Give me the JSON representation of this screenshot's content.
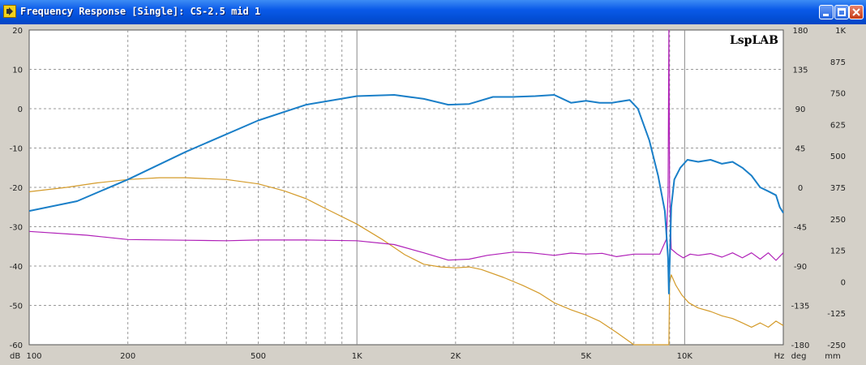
{
  "window": {
    "title": "Frequency Response [Single]: CS-2.5 mid 1",
    "minimize_label": "minimize",
    "maximize_label": "maximize",
    "close_label": "close"
  },
  "watermark": "LspLAB",
  "colors": {
    "spl": "#1a7fc8",
    "phase": "#d49b2a",
    "excursion": "#b020b8",
    "grid": "#7a7a7a",
    "background": "#ffffff"
  },
  "chart_data": {
    "type": "line",
    "x_scale": "log",
    "xlim": [
      100,
      20000
    ],
    "x_ticks": [
      {
        "value": 100,
        "label": "100"
      },
      {
        "value": 200,
        "label": "200"
      },
      {
        "value": 500,
        "label": "500"
      },
      {
        "value": 1000,
        "label": "1K"
      },
      {
        "value": 2000,
        "label": "2K"
      },
      {
        "value": 5000,
        "label": "5K"
      },
      {
        "value": 10000,
        "label": "10K"
      }
    ],
    "x_unit": "Hz",
    "y_left": {
      "unit": "dB",
      "lim": [
        -60,
        20
      ],
      "ticks": [
        20,
        10,
        0,
        -10,
        -20,
        -30,
        -40,
        -50,
        -60
      ]
    },
    "y_right1": {
      "unit": "deg",
      "lim": [
        -180,
        180
      ],
      "ticks": [
        180,
        135,
        90,
        45,
        0,
        -45,
        -90,
        -135,
        -180
      ]
    },
    "y_right2": {
      "unit": "mm",
      "lim": [
        "-250",
        "1K"
      ],
      "ticks": [
        "1K",
        "875",
        "750",
        "625",
        "500",
        "375",
        "250",
        "125",
        "0",
        "-125",
        "-250"
      ]
    },
    "grid": true,
    "series": [
      {
        "axis": "dB",
        "color": "#1a7fc8",
        "points": [
          [
            100,
            -26
          ],
          [
            140,
            -23.5
          ],
          [
            200,
            -18
          ],
          [
            300,
            -11
          ],
          [
            500,
            -3
          ],
          [
            700,
            1
          ],
          [
            1000,
            3.2
          ],
          [
            1300,
            3.5
          ],
          [
            1600,
            2.5
          ],
          [
            1900,
            1
          ],
          [
            2200,
            1.2
          ],
          [
            2600,
            3
          ],
          [
            3000,
            3
          ],
          [
            3500,
            3.2
          ],
          [
            4000,
            3.5
          ],
          [
            4500,
            1.5
          ],
          [
            5000,
            2
          ],
          [
            5500,
            1.5
          ],
          [
            6000,
            1.5
          ],
          [
            6800,
            2.2
          ],
          [
            7200,
            0
          ],
          [
            7800,
            -8
          ],
          [
            8300,
            -17
          ],
          [
            8700,
            -26
          ],
          [
            8900,
            -38
          ],
          [
            8950,
            -47
          ],
          [
            9000,
            -40
          ],
          [
            9100,
            -25
          ],
          [
            9300,
            -18
          ],
          [
            9700,
            -15
          ],
          [
            10200,
            -13
          ],
          [
            11000,
            -13.5
          ],
          [
            12000,
            -13
          ],
          [
            13000,
            -14
          ],
          [
            14000,
            -13.5
          ],
          [
            15000,
            -15
          ],
          [
            16000,
            -17
          ],
          [
            17000,
            -20
          ],
          [
            18000,
            -21
          ],
          [
            19000,
            -22
          ],
          [
            19500,
            -25
          ],
          [
            20000,
            -26.5
          ]
        ]
      },
      {
        "axis": "deg",
        "color": "#d49b2a",
        "points": [
          [
            100,
            -5
          ],
          [
            130,
            0
          ],
          [
            160,
            5
          ],
          [
            200,
            9
          ],
          [
            250,
            11
          ],
          [
            300,
            11
          ],
          [
            400,
            9
          ],
          [
            500,
            4
          ],
          [
            600,
            -4
          ],
          [
            700,
            -13
          ],
          [
            800,
            -24
          ],
          [
            1000,
            -42
          ],
          [
            1200,
            -60
          ],
          [
            1400,
            -77
          ],
          [
            1600,
            -88
          ],
          [
            1800,
            -91
          ],
          [
            2000,
            -92
          ],
          [
            2200,
            -91
          ],
          [
            2400,
            -94
          ],
          [
            2800,
            -103
          ],
          [
            3200,
            -112
          ],
          [
            3600,
            -121
          ],
          [
            4000,
            -132
          ],
          [
            4500,
            -140
          ],
          [
            5000,
            -146
          ],
          [
            5500,
            -153
          ],
          [
            6200,
            -166
          ],
          [
            7000,
            -198
          ],
          [
            7800,
            -233
          ],
          [
            8400,
            -258
          ],
          [
            8800,
            -268
          ],
          [
            8950,
            -272
          ],
          [
            9000,
            -110
          ],
          [
            9100,
            -100
          ],
          [
            9400,
            -112
          ],
          [
            9800,
            -123
          ],
          [
            10300,
            -132
          ],
          [
            11000,
            -138
          ],
          [
            12000,
            -142
          ],
          [
            13000,
            -147
          ],
          [
            14000,
            -150
          ],
          [
            15000,
            -155
          ],
          [
            16000,
            -160
          ],
          [
            17000,
            -155
          ],
          [
            18000,
            -160
          ],
          [
            19000,
            -153
          ],
          [
            20000,
            -158
          ]
        ]
      },
      {
        "axis": "mm",
        "color": "#b020b8",
        "points": [
          [
            100,
            200
          ],
          [
            150,
            185
          ],
          [
            200,
            168
          ],
          [
            300,
            165
          ],
          [
            400,
            163
          ],
          [
            500,
            166
          ],
          [
            700,
            166
          ],
          [
            1000,
            163
          ],
          [
            1300,
            148
          ],
          [
            1600,
            115
          ],
          [
            1900,
            86
          ],
          [
            2200,
            90
          ],
          [
            2500,
            105
          ],
          [
            3000,
            118
          ],
          [
            3400,
            115
          ],
          [
            4000,
            105
          ],
          [
            4500,
            114
          ],
          [
            5000,
            110
          ],
          [
            5600,
            113
          ],
          [
            6200,
            100
          ],
          [
            7000,
            110
          ],
          [
            7800,
            110
          ],
          [
            8400,
            110
          ],
          [
            8800,
            170
          ],
          [
            8900,
            350
          ],
          [
            8950,
            1000
          ],
          [
            9000,
            350
          ],
          [
            9100,
            130
          ],
          [
            9500,
            110
          ],
          [
            9900,
            95
          ],
          [
            10400,
            110
          ],
          [
            11000,
            105
          ],
          [
            12000,
            112
          ],
          [
            13000,
            98
          ],
          [
            14000,
            115
          ],
          [
            15000,
            95
          ],
          [
            16000,
            115
          ],
          [
            17000,
            90
          ],
          [
            18000,
            115
          ],
          [
            19000,
            85
          ],
          [
            20000,
            115
          ]
        ]
      }
    ]
  },
  "axes": {
    "y_left_unit": "dB",
    "x_unit": "Hz",
    "y_right1_unit": "deg",
    "y_right2_unit": "mm",
    "x_labels": [
      "100",
      "200",
      "500",
      "1K",
      "2K",
      "5K",
      "10K"
    ],
    "y_left_labels": [
      "20",
      "10",
      "0",
      "-10",
      "-20",
      "-30",
      "-40",
      "-50",
      "-60"
    ],
    "y_right1_labels": [
      "180",
      "135",
      "90",
      "45",
      "0",
      "-45",
      "-90",
      "-135",
      "-180"
    ],
    "y_right2_labels": [
      "1K",
      "875",
      "750",
      "625",
      "500",
      "375",
      "250",
      "125",
      "0",
      "-125",
      "-250"
    ]
  }
}
